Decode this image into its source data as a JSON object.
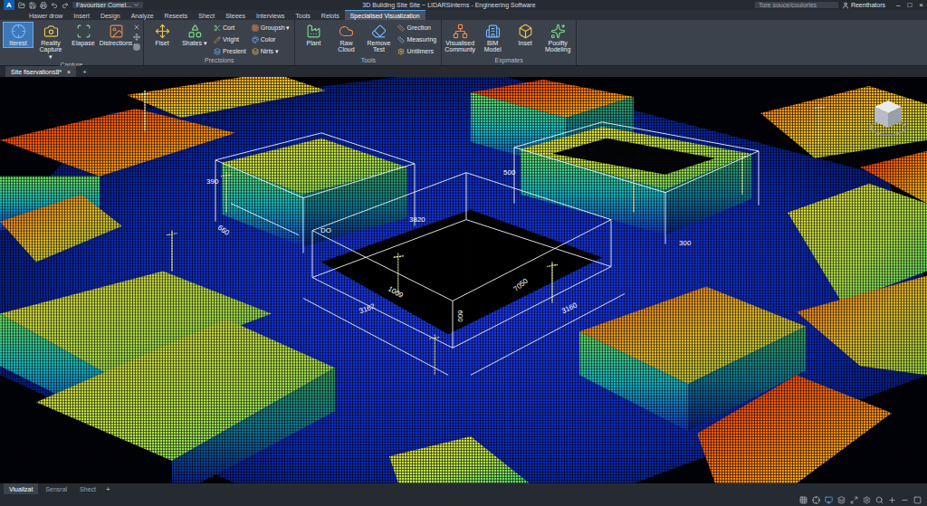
{
  "app": {
    "logo": "A",
    "workspace": "Favouriser Comel...",
    "title": "3D Building Site Site ~ LIDARSinterns - Engineering Software",
    "search": {
      "placeholder": "Tore souce/coulorles"
    },
    "user": "Reenthators",
    "window_controls": [
      "–",
      "□",
      "×"
    ]
  },
  "ribbon_tabs": [
    {
      "label": "Hawer drow",
      "selected": false
    },
    {
      "label": "Insert",
      "selected": false
    },
    {
      "label": "Design",
      "selected": false
    },
    {
      "label": "Analyze",
      "selected": false
    },
    {
      "label": "Reseets",
      "selected": false
    },
    {
      "label": "Shect",
      "selected": false
    },
    {
      "label": "Steees",
      "selected": false
    },
    {
      "label": "Interviews",
      "selected": false
    },
    {
      "label": "Tools",
      "selected": false
    },
    {
      "label": "Relots",
      "selected": false
    },
    {
      "label": "Specialised Visualization",
      "selected": true
    }
  ],
  "panels": [
    {
      "title": "Capture",
      "tools": [
        {
          "label": "Iterest",
          "kind": "large",
          "selected": true
        },
        {
          "label": "Reality Capture ▾",
          "kind": "large",
          "selected": false
        },
        {
          "label": "Elapase",
          "kind": "large",
          "selected": false
        },
        {
          "label": "Distrections",
          "kind": "large",
          "selected": false
        }
      ]
    },
    {
      "title": "Precisions",
      "tools": [
        {
          "label": "Fiset",
          "kind": "large",
          "selected": false
        },
        {
          "label": "Shates ▾",
          "kind": "large",
          "selected": false
        },
        {
          "label": "Cort",
          "kind": "small",
          "selected": false
        },
        {
          "label": "Vright",
          "kind": "small",
          "selected": false
        },
        {
          "label": "Preslent",
          "kind": "small",
          "selected": false
        },
        {
          "label": "Groupsh ▾",
          "kind": "small",
          "selected": false
        },
        {
          "label": "Color",
          "kind": "small",
          "selected": false
        },
        {
          "label": "Nirts ▾",
          "kind": "small",
          "selected": false
        }
      ]
    },
    {
      "title": "Tools",
      "tools": [
        {
          "label": "Plant",
          "kind": "large",
          "selected": false
        },
        {
          "label": "Raw Cloud",
          "kind": "large",
          "selected": false
        },
        {
          "label": "Remove Test",
          "kind": "large",
          "selected": false
        },
        {
          "label": "Grection",
          "kind": "small",
          "selected": false
        },
        {
          "label": "Measuring",
          "kind": "small",
          "selected": false
        },
        {
          "label": "Untilmers",
          "kind": "small",
          "selected": false
        }
      ]
    },
    {
      "title": "Expmates",
      "tools": [
        {
          "label": "Visualised Communty",
          "kind": "large",
          "selected": false
        },
        {
          "label": "BIM Model",
          "kind": "large",
          "selected": false
        },
        {
          "label": "Inset",
          "kind": "large",
          "selected": false
        },
        {
          "label": "Poolfty Modeling",
          "kind": "large",
          "selected": false
        }
      ]
    }
  ],
  "document_tabs": [
    {
      "label": "Site fiservations8*",
      "selected": true,
      "close": "×"
    }
  ],
  "new_document": "+",
  "viewport": {
    "dimensions": [
      {
        "text": "390"
      },
      {
        "text": "DO"
      },
      {
        "text": "660"
      },
      {
        "text": "3820"
      },
      {
        "text": "500"
      },
      {
        "text": "300"
      },
      {
        "text": "1009"
      },
      {
        "text": "3162"
      },
      {
        "text": "7050"
      },
      {
        "text": "3160"
      },
      {
        "text": "600"
      }
    ]
  },
  "layout_tabs": [
    {
      "label": "Viualizat",
      "selected": true
    },
    {
      "label": "Sensral",
      "selected": false
    },
    {
      "label": "Shect",
      "selected": false
    }
  ],
  "new_layout": "+"
}
